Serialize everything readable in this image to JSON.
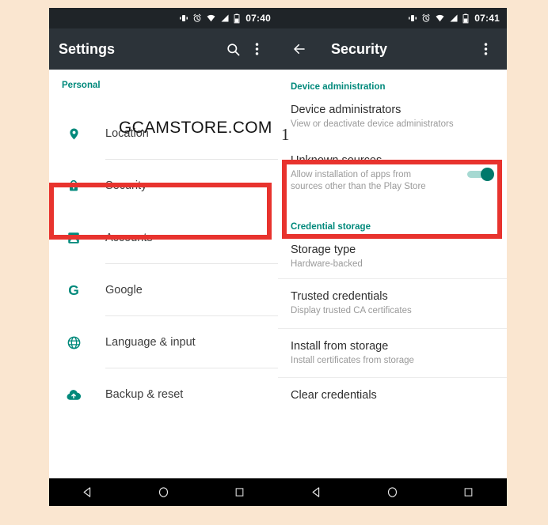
{
  "watermark": "GCAMSTORE.COM",
  "annotation_marker": "1",
  "colors": {
    "accent_teal": "#00897b",
    "highlight_red": "#e8332e",
    "toolbar_dark": "#2c3339",
    "status_bar_dark": "#1f2428",
    "page_background": "#fae6d0"
  },
  "left_pane": {
    "status_bar": {
      "time": "07:40",
      "icons": [
        "vibrate-icon",
        "alarm-icon",
        "wifi-icon",
        "signal-icon",
        "battery-icon"
      ]
    },
    "toolbar": {
      "title": "Settings",
      "search_icon": "search-icon",
      "overflow_icon": "more-vert-icon"
    },
    "section_label": "Personal",
    "items": [
      {
        "label": "Location",
        "icon": "location-pin-icon"
      },
      {
        "label": "Security",
        "icon": "lock-icon",
        "highlighted": true
      },
      {
        "label": "Accounts",
        "icon": "account-box-icon"
      },
      {
        "label": "Google",
        "icon": "google-g-icon"
      },
      {
        "label": "Language & input",
        "icon": "globe-icon"
      },
      {
        "label": "Backup & reset",
        "icon": "backup-cloud-icon"
      }
    ],
    "nav_bar": [
      "back-triangle-icon",
      "home-circle-icon",
      "recents-square-icon"
    ]
  },
  "right_pane": {
    "status_bar": {
      "time": "07:41",
      "icons": [
        "vibrate-icon",
        "alarm-icon",
        "wifi-icon",
        "signal-icon",
        "battery-icon"
      ]
    },
    "toolbar": {
      "back_icon": "arrow-back-icon",
      "title": "Security",
      "overflow_icon": "more-vert-icon"
    },
    "sections": [
      {
        "header": "Device administration",
        "rows": [
          {
            "title": "Device administrators",
            "subtitle": "View or deactivate device administrators"
          },
          {
            "title": "Unknown sources",
            "subtitle": "Allow installation of apps from sources other than the Play Store",
            "toggle": "on",
            "highlighted": true
          }
        ]
      },
      {
        "header": "Credential storage",
        "rows": [
          {
            "title": "Storage type",
            "subtitle": "Hardware-backed"
          },
          {
            "title": "Trusted credentials",
            "subtitle": "Display trusted CA certificates"
          },
          {
            "title": "Install from storage",
            "subtitle": "Install certificates from storage"
          },
          {
            "title": "Clear credentials",
            "subtitle": ""
          }
        ]
      }
    ],
    "nav_bar": [
      "back-triangle-icon",
      "home-circle-icon",
      "recents-square-icon"
    ]
  }
}
